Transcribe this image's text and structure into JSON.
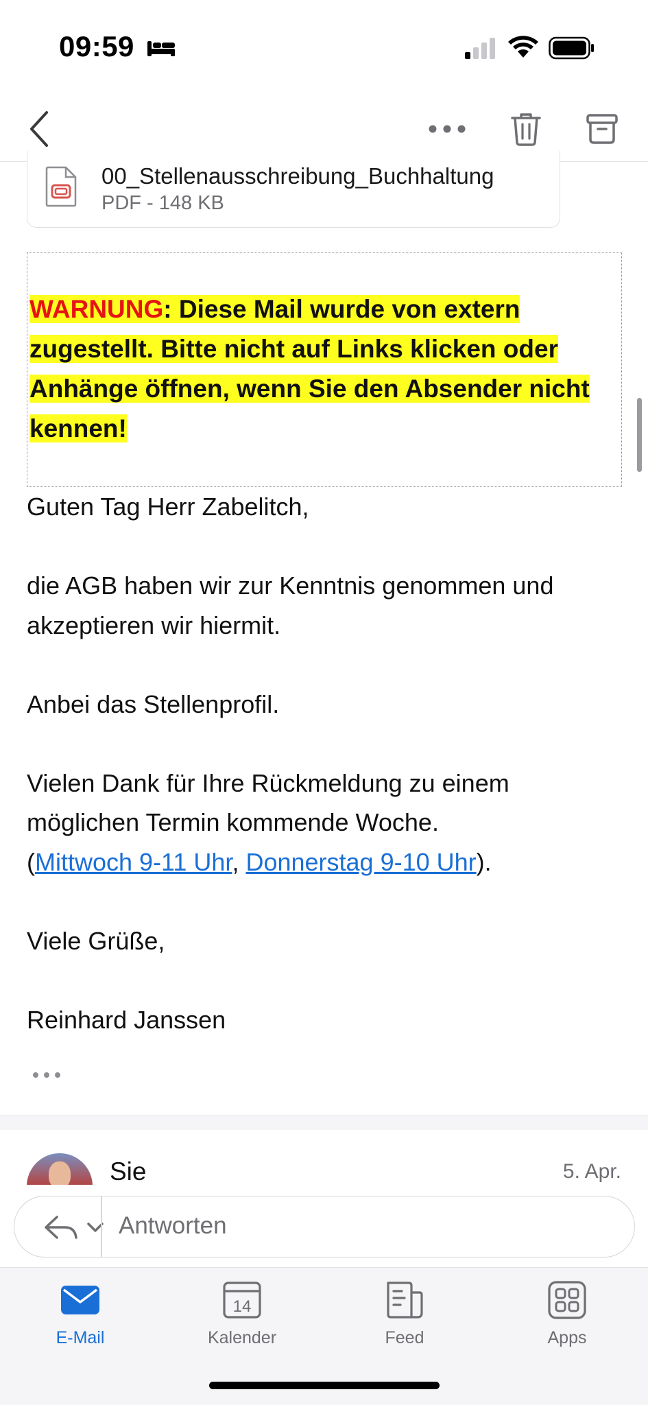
{
  "status_bar": {
    "time": "09:59"
  },
  "attachment": {
    "name": "00_Stellenausschreibung_Buchhaltung",
    "meta": "PDF - 148 KB"
  },
  "warning": {
    "label": "WARNUNG",
    "text": ": Diese Mail wurde von extern zugestellt. Bitte nicht auf Links klicken oder Anhänge öffnen, wenn Sie den Absender nicht kennen!"
  },
  "mail_body": {
    "greeting": "Guten Tag Herr Zabelitch,",
    "paragraph1": "die AGB haben wir zur Kenntnis genommen und akzeptieren wir hiermit.",
    "paragraph2": "Anbei das Stellenprofil.",
    "paragraph3": "Vielen Dank für Ihre Rückmeldung zu einem möglichen Termin kommende Woche.",
    "paren_open": "(",
    "link1": "Mittwoch 9-11 Uhr",
    "comma": ", ",
    "link2": "Donnerstag 9-10 Uhr",
    "paren_close": ").",
    "closing": "Viele Grüße,",
    "signature": "Reinhard Janssen"
  },
  "next_message": {
    "sender": "Sie",
    "date": "5. Apr."
  },
  "reply": {
    "placeholder": "Antworten"
  },
  "tabs": [
    {
      "label": "E-Mail",
      "icon": "mail-icon",
      "active": true
    },
    {
      "label": "Kalender",
      "icon": "calendar-icon",
      "day": "14"
    },
    {
      "label": "Feed",
      "icon": "feed-icon"
    },
    {
      "label": "Apps",
      "icon": "apps-icon"
    }
  ],
  "colors": {
    "accent": "#1a6fd6",
    "warning_highlight": "#ffff1f",
    "warning_red": "#e51414",
    "pdf_red": "#d9534f"
  }
}
